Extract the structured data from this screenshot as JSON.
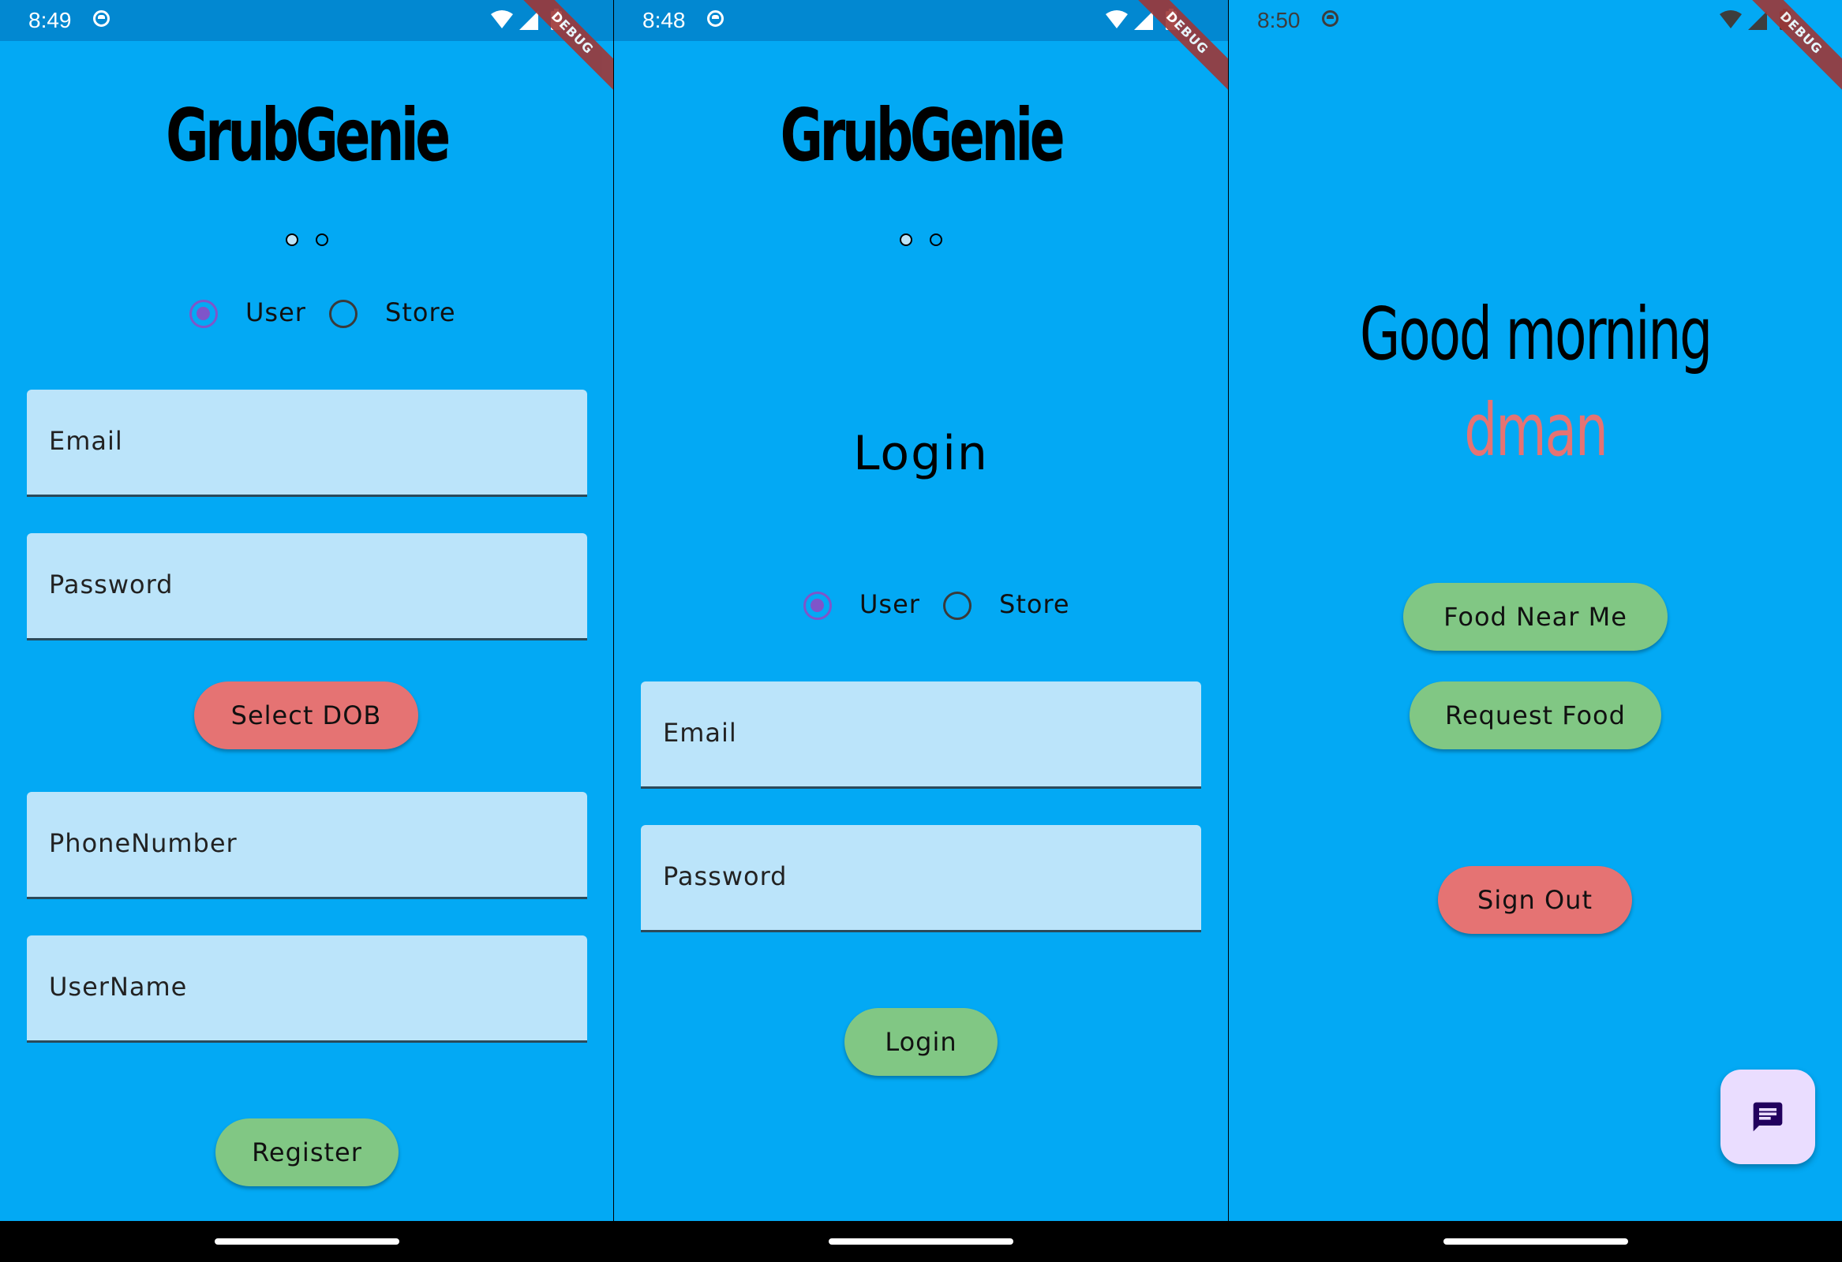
{
  "colors": {
    "background": "#03A9F4",
    "status_bar": "#0288D1",
    "field": "#BBE4FA",
    "button_green": "#81C784",
    "button_red": "#E57373",
    "radio_selected": "#7F55C9",
    "fab": "#EADDFF",
    "debug_ribbon": "#9E3737"
  },
  "debug_banner": "DEBUG",
  "register_screen": {
    "status_time": "8:49",
    "app_title": "GrubGenie",
    "page_indicator": {
      "pages": 2,
      "active_index": 0
    },
    "account_type": {
      "options": [
        "User",
        "Store"
      ],
      "selected": "User"
    },
    "fields": {
      "email": "Email",
      "password": "Password",
      "phone": "PhoneNumber",
      "username": "UserName"
    },
    "select_dob_label": "Select DOB",
    "register_label": "Register"
  },
  "login_screen": {
    "status_time": "8:48",
    "app_title": "GrubGenie",
    "page_indicator": {
      "pages": 2,
      "active_index": 0
    },
    "heading": "Login",
    "account_type": {
      "options": [
        "User",
        "Store"
      ],
      "selected": "User"
    },
    "fields": {
      "email": "Email",
      "password": "Password"
    },
    "login_label": "Login"
  },
  "home_screen": {
    "status_time": "8:50",
    "greeting": "Good morning",
    "username": "dman",
    "food_near_me_label": "Food Near Me",
    "request_food_label": "Request Food",
    "sign_out_label": "Sign Out",
    "fab_icon": "chat-icon"
  }
}
